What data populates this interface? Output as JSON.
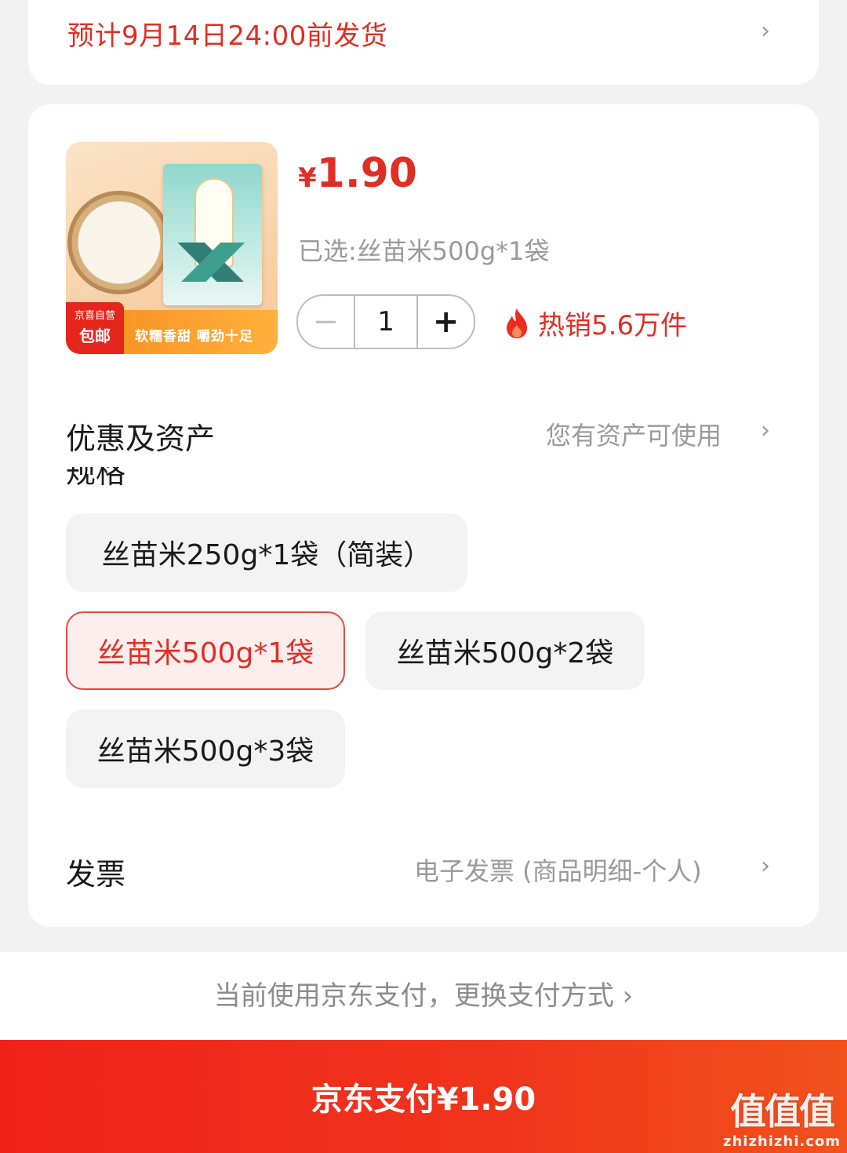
{
  "shipping": {
    "text": "预计9月14日24:00前发货"
  },
  "product": {
    "image": {
      "tag_top": "京喜自营",
      "tag_main": "包邮",
      "slogan": "软糯香甜 嚼劲十足"
    },
    "price_currency": "¥",
    "price_value": "1.90",
    "selected_text": "已选:丝苗米500g*1袋",
    "quantity": "1",
    "minus_symbol": "−",
    "plus_symbol": "+",
    "hot_sales": "热销5.6万件"
  },
  "discount": {
    "title": "优惠及资产",
    "value": "您有资产可使用"
  },
  "spec": {
    "title": "规格",
    "options": [
      "丝苗米250g*1袋（简装）",
      "丝苗米500g*1袋",
      "丝苗米500g*2袋",
      "丝苗米500g*3袋"
    ],
    "selected_index": 1
  },
  "invoice": {
    "title": "发票",
    "value": "电子发票 (商品明细-个人)"
  },
  "payment": {
    "note": "当前使用京东支付，更换支付方式 ›",
    "button": "京东支付¥1.90"
  },
  "watermark": {
    "glyph": "值值值",
    "domain": "zhizhizhi.com"
  },
  "icons": {
    "chevron": "chevron-right-icon",
    "flame": "flame-icon"
  },
  "colors": {
    "accent": "#e02e24",
    "pay_button": "#f0231b"
  }
}
